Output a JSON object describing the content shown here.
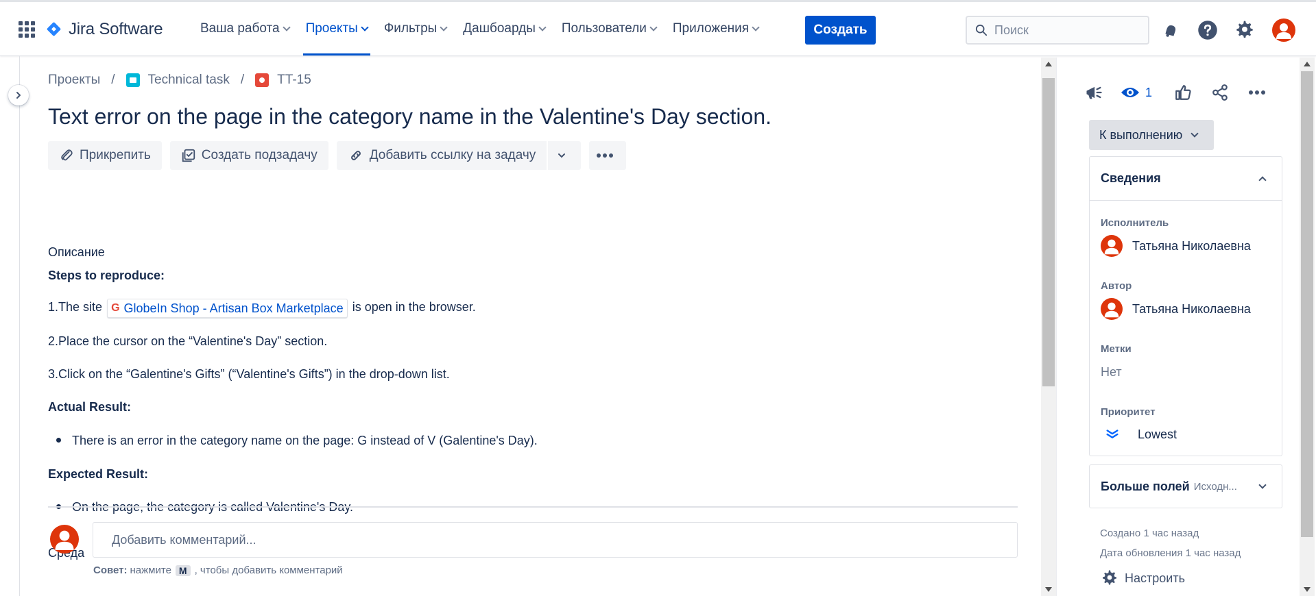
{
  "nav": {
    "logo_text": "Jira Software",
    "items": [
      {
        "label": "Ваша работа",
        "active": false
      },
      {
        "label": "Проекты",
        "active": true
      },
      {
        "label": "Фильтры",
        "active": false
      },
      {
        "label": "Дашбоарды",
        "active": false
      },
      {
        "label": "Пользователи",
        "active": false
      },
      {
        "label": "Приложения",
        "active": false
      }
    ],
    "create_label": "Создать",
    "search_placeholder": "Поиск",
    "icons": [
      "app-switcher-icon",
      "notifications-icon",
      "help-icon",
      "settings-icon",
      "profile-avatar"
    ]
  },
  "breadcrumb": {
    "projects": "Проекты",
    "project": "Technical task",
    "issue": "TT-15"
  },
  "issue": {
    "title": "Text error on the page in the category name in the Valentine's Day section."
  },
  "toolbar": {
    "attach": "Прикрепить",
    "subtask": "Создать подзадачу",
    "link": "Добавить ссылку на задачу"
  },
  "description": {
    "label": "Описание",
    "steps_heading": "Steps to reproduce:",
    "step1_prefix": "1.The site",
    "step1_link": "GlobeIn Shop - Artisan Box Marketplace",
    "step1_suffix": "is open in the browser.",
    "step2": "2.Place the cursor on the “Valentine's Day” section.",
    "step3": "3.Click on the “Galentine's Gifts” (“Valentine's Gifts”) in the drop-down list.",
    "actual_heading": "Actual Result:",
    "actual_item": "There is an error in the category name on the page: G instead of V (Galentine's Day).",
    "expected_heading": "Expected Result:",
    "expected_item": "On the page, the category is called Valentine's Day.",
    "environment_label": "Среда"
  },
  "comment": {
    "placeholder": "Добавить комментарий...",
    "tip_label": "Совет:",
    "tip_before": "нажмите",
    "tip_key": "M",
    "tip_after": ", чтобы добавить комментарий"
  },
  "sidebar": {
    "watch_count": "1",
    "status": "К выполнению",
    "details_title": "Сведения",
    "assignee_label": "Исполнитель",
    "assignee": "Татьяна Николаевна",
    "reporter_label": "Автор",
    "reporter": "Татьяна Николаевна",
    "labels_label": "Метки",
    "labels_value": "Нет",
    "priority_label": "Приоритет",
    "priority_value": "Lowest",
    "more_fields": "Больше полей",
    "more_fields_hint": "Исходн...",
    "created": "Создано 1 час назад",
    "updated": "Дата обновления 1 час назад",
    "configure": "Настроить"
  },
  "colors": {
    "brand": "#0052cc",
    "avatar": "#de350b",
    "priority_lowest": "#0065ff"
  }
}
